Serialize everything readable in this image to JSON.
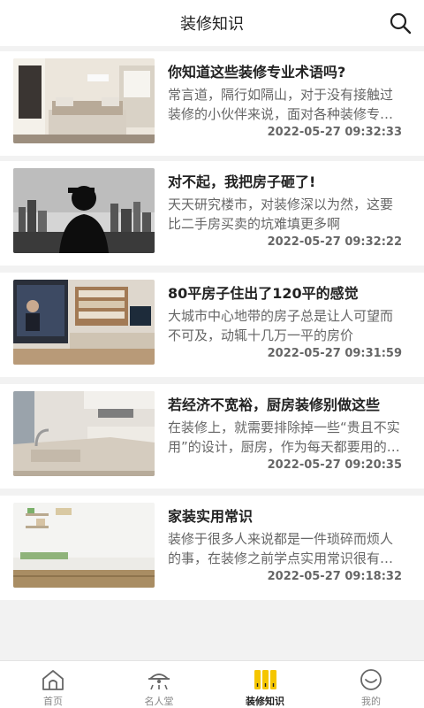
{
  "header": {
    "title": "装修知识",
    "search_icon": "search-icon"
  },
  "articles": [
    {
      "title": "你知道这些装修专业术语吗?",
      "desc": "常言道，隔行如隔山，对于没有接触过装修的小伙伴来说，面对各种装修专业术语",
      "date": "2022-05-27 09:32:33",
      "image": "bedroom-photo"
    },
    {
      "title": "对不起，我把房子砸了!",
      "desc": "天天研究楼市，对装修深以为然，这要比二手房买卖的坑难填更多啊",
      "date": "2022-05-27 09:32:22",
      "image": "city-silhouette-photo"
    },
    {
      "title": "80平房子住出了120平的感觉",
      "desc": "大城市中心地带的房子总是让人可望而不可及，动辄十几万一平的房价",
      "date": "2022-05-27 09:31:59",
      "image": "living-room-photo"
    },
    {
      "title": "若经济不宽裕，厨房装修别做这些",
      "desc": "在装修上，就需要排除掉一些“贵且不实用”的设计，厨房，作为每天都要用的地方",
      "date": "2022-05-27 09:20:35",
      "image": "kitchen-photo"
    },
    {
      "title": "家装实用常识",
      "desc": "装修于很多人来说都是一件琐碎而烦人的事，在装修之前学点实用常识很有必要",
      "date": "2022-05-27 09:18:32",
      "image": "white-wall-photo"
    }
  ],
  "tabbar": {
    "items": [
      {
        "label": "首页",
        "icon": "home-icon"
      },
      {
        "label": "名人堂",
        "icon": "hall-of-fame-icon"
      },
      {
        "label": "装修知识",
        "icon": "renovation-knowledge-icon"
      },
      {
        "label": "我的",
        "icon": "smiley-icon"
      }
    ],
    "active_color": "#f5c600"
  }
}
